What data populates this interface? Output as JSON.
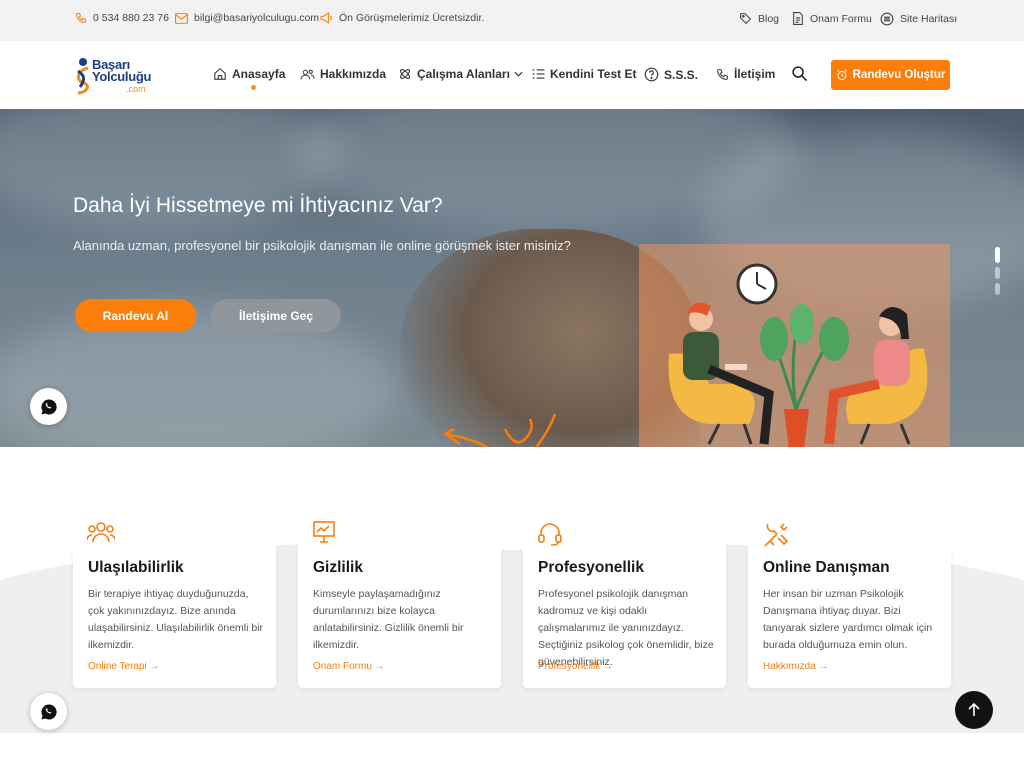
{
  "topbar": {
    "phone": "0 534 880 23 76",
    "email": "bilgi@basariyolculugu.com",
    "promo": "Ön Görüşmelerimiz Ücretsizdir.",
    "blog": "Blog",
    "consent": "Onam Formu",
    "sitemap": "Site Haritası"
  },
  "logo": {
    "line1": "Başarı",
    "line2": "Yolculuğu",
    "line3": ".com"
  },
  "nav": {
    "home": "Anasayfa",
    "about": "Hakkımızda",
    "areas": "Çalışma Alanları",
    "test": "Kendini Test Et",
    "faq": "S.S.S.",
    "contact": "İletişim",
    "cta": "Randevu Oluştur"
  },
  "hero": {
    "title": "Daha İyi Hissetmeye mi İhtiyacınız Var?",
    "subtitle": "Alanında uzman, profesyonel bir psikolojik danışman ile online görüşmek ister misiniz?",
    "btn_primary": "Randevu Al",
    "btn_secondary": "İletişime Geç"
  },
  "features": [
    {
      "title": "Ulaşılabilirlik",
      "text": "Bir terapiye ihtiyaç duyduğunuzda, çok yakınınızdayız. Bize anında ulaşabilirsiniz. Ulaşılabilirlik önemli bir ilkemizdir.",
      "link": "Online Terapi →"
    },
    {
      "title": "Gizlilik",
      "text": "Kimseyle paylaşamadığınız durumlarınızı bize kolayca anlatabilirsiniz. Gizlilik önemli bir ilkemizdir.",
      "link": "Onam Formu →"
    },
    {
      "title": "Profesyonellik",
      "text": "Profesyonel psikolojik danışman kadromuz ve kişi odaklı çalışmalarımız ile yanınızdayız. Seçtiğiniz psikolog çok önemlidir, bize güvenebilirsiniz.",
      "link": "Profesyonellik →"
    },
    {
      "title": "Online Danışman",
      "text": "Her insan bir uzman Psikolojik Danışmana ihtiyaç duyar. Bizi tanıyarak sizlere yardımcı olmak için burada olduğumuza emin olun.",
      "link": "Hakkımızda →"
    }
  ],
  "colors": {
    "accent": "#fb7d0a",
    "brand": "#1f3c88"
  }
}
